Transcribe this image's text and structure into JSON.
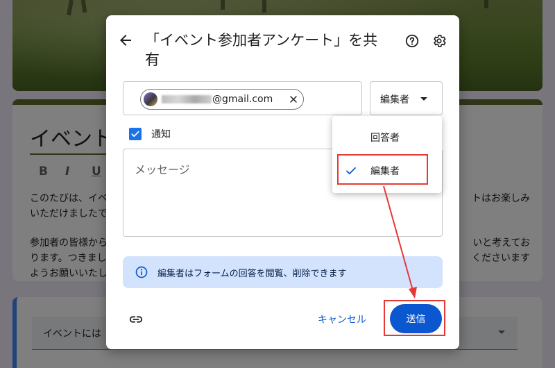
{
  "background_form": {
    "title": "イベント",
    "format_buttons": [
      "B",
      "I",
      "U"
    ],
    "description_lines": [
      "このたびは、イベ",
      "いただけましたで",
      "",
      "参加者の皆様から",
      "ります。つきまし",
      "ようお願いいたし"
    ],
    "description_right": [
      "トはお楽しみ",
      "",
      "",
      "いと考えてお",
      "くださいます",
      ""
    ],
    "question_label": "イベントには"
  },
  "dialog": {
    "title": "「イベント参加者アンケート」を共有",
    "recipient": {
      "email_visible_part": "@gmail.com"
    },
    "role_select": {
      "selected": "編集者"
    },
    "notify": {
      "label": "通知",
      "checked": true
    },
    "message": {
      "placeholder": "メッセージ"
    },
    "info_banner": {
      "text": "編集者はフォームの回答を閲覧、削除できます"
    },
    "buttons": {
      "cancel": "キャンセル",
      "send": "送信"
    },
    "icons": {
      "back": "arrow-left-icon",
      "help": "help-circle-icon",
      "settings": "gear-icon",
      "link": "link-icon",
      "info": "info-icon",
      "close": "close-icon",
      "check": "check-icon"
    }
  },
  "role_menu": {
    "items": [
      {
        "label": "回答者",
        "selected": false
      },
      {
        "label": "編集者",
        "selected": true
      }
    ]
  },
  "colors": {
    "accent": "#0b57d0",
    "banner": "#d3e3fd",
    "annotation": "#e53935",
    "theme": "#5f6a2f"
  }
}
